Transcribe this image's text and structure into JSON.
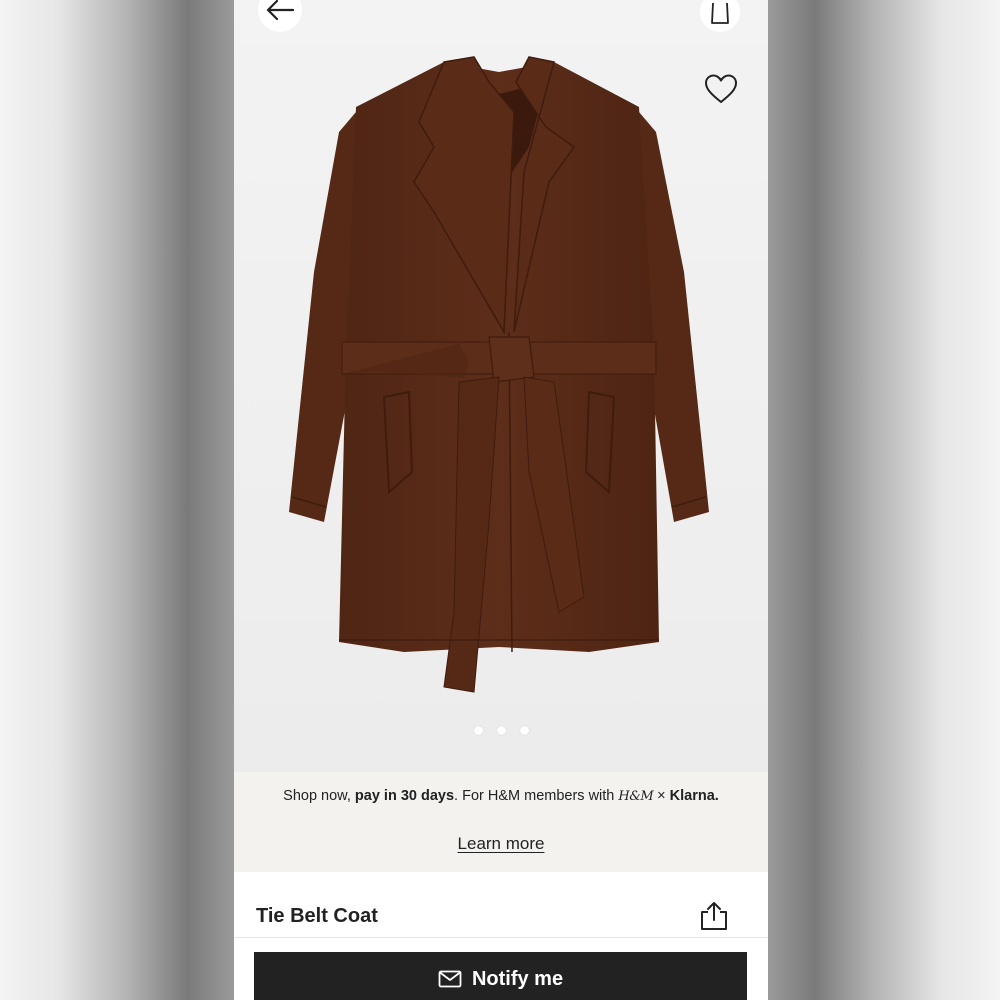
{
  "product": {
    "title": "Tie Belt Coat",
    "carousel": {
      "total_images": 3,
      "active_index": 0
    }
  },
  "klarna": {
    "text_prefix": "Shop now, ",
    "text_bold": "pay in 30 days",
    "text_middle": ". For H&M members with ",
    "hm_logo": "H&M",
    "times": "×",
    "klarna_logo": "Klarna.",
    "learn_more": "Learn more"
  },
  "actions": {
    "notify_label": "Notify me"
  },
  "icons": {
    "back": "arrow-left-icon",
    "bag": "shopping-bag-icon",
    "favorite": "heart-icon",
    "share": "share-icon",
    "notify": "envelope-icon"
  },
  "colors": {
    "coat": "#5a2c18",
    "button_bg": "#222222",
    "banner_bg": "#f4f2ef"
  }
}
